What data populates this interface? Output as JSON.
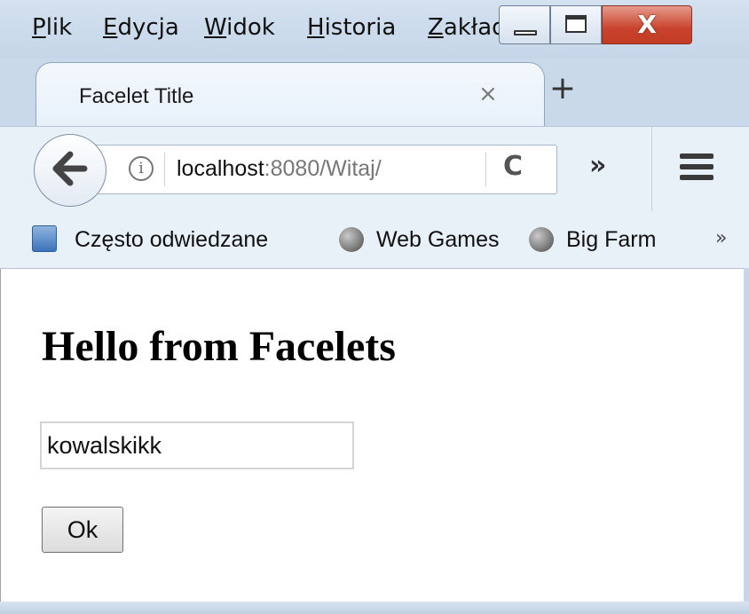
{
  "menu": {
    "file": {
      "accel": "P",
      "rest": "lik"
    },
    "edit": {
      "accel": "E",
      "rest": "dycja"
    },
    "view": {
      "accel": "W",
      "rest": "idok"
    },
    "history": {
      "accel": "H",
      "rest": "istoria"
    },
    "bookmarks": {
      "accel": "Z",
      "rest": "akładk"
    }
  },
  "window_controls": {
    "minimize_icon": "minimize-icon",
    "maximize_icon": "maximize-icon",
    "close_icon": "close-icon",
    "close_glyph": "X",
    "close_color": "#c8432d"
  },
  "tab": {
    "title": "Facelet Title",
    "close_glyph": "×",
    "new_tab_glyph": "+"
  },
  "navigation": {
    "url_host": "localhost",
    "url_rest": ":8080/Witaj/",
    "info_glyph": "i",
    "reload_glyph": "C",
    "overflow_glyph": "»"
  },
  "bookmarks": {
    "items": [
      {
        "label": "Często odwiedzane",
        "icon": "most-visited-icon"
      },
      {
        "label": "Web Games",
        "icon": "globe-icon"
      },
      {
        "label": "Big Farm",
        "icon": "globe-icon"
      }
    ],
    "overflow_glyph": "»"
  },
  "page": {
    "heading": "Hello from Facelets",
    "input_value": "kowalskikk",
    "ok_label": "Ok"
  }
}
